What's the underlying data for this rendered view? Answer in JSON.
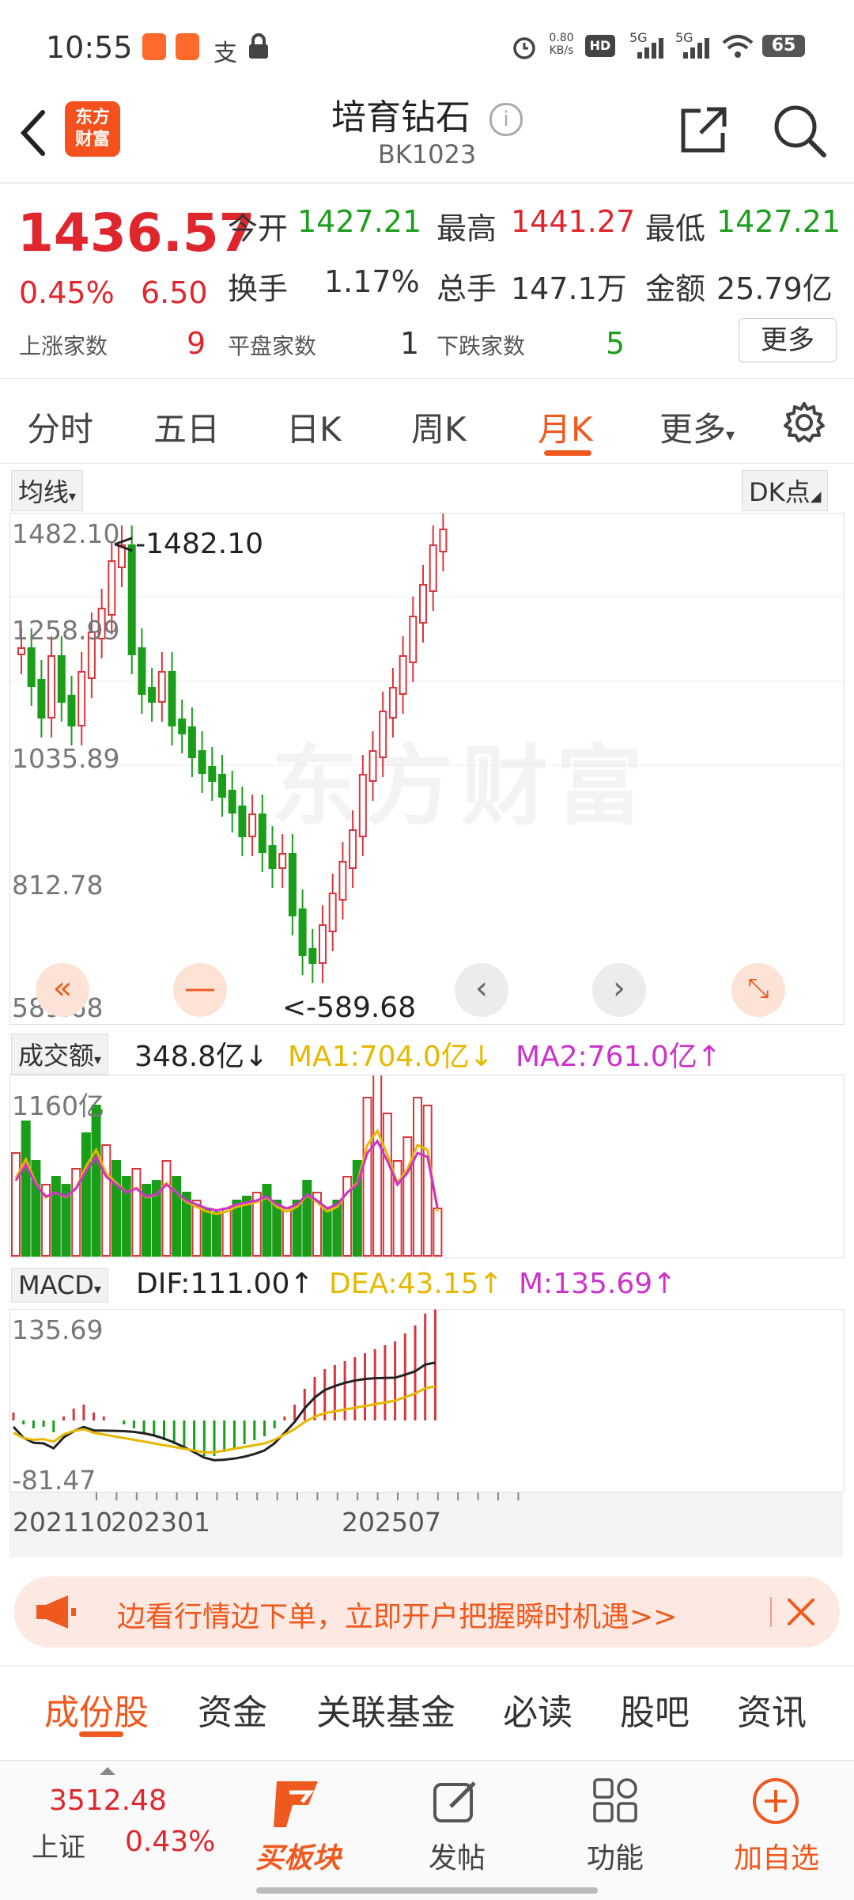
{
  "status_bar": {
    "time": "10:55",
    "net_speed_value": "0.80",
    "net_speed_unit": "KB/s",
    "sim1": "5G",
    "sim2": "5G",
    "battery": "65"
  },
  "header": {
    "title": "培育钻石",
    "code": "BK1023",
    "brand_line1": "东方",
    "brand_line2": "财富"
  },
  "quote": {
    "price": "1436.57",
    "change_pct": "0.45%",
    "change": "6.50",
    "open_label": "今开",
    "open": "1427.21",
    "high_label": "最高",
    "high": "1441.27",
    "low_label": "最低",
    "low": "1427.21",
    "turnover_label": "换手",
    "turnover": "1.17%",
    "volume_label": "总手",
    "volume": "147.1万",
    "amount_label": "金额",
    "amount": "25.79亿",
    "up_label": "上涨家数",
    "up": "9",
    "flat_label": "平盘家数",
    "flat": "1",
    "down_label": "下跌家数",
    "down": "5",
    "more_button": "更多"
  },
  "period_tabs": {
    "items": [
      "分时",
      "五日",
      "日K",
      "周K",
      "月K",
      "更多"
    ],
    "active": "月K"
  },
  "chart": {
    "ma_selector": "均线",
    "dk_selector": "DK点",
    "y_labels": [
      "1482.10",
      "1258.99",
      "1035.89",
      "812.78",
      "589.68"
    ],
    "max_marker": "<-1482.10",
    "min_marker": "<-589.68",
    "watermark": "东方财富",
    "volume_selector": "成交额",
    "volume_value": "348.8亿↓",
    "ma1": "MA1:704.0亿↓",
    "ma2": "MA2:761.0亿↑",
    "volume_max": "1160亿",
    "macd_selector": "MACD",
    "dif": "DIF:111.00↑",
    "dea": "DEA:43.15↑",
    "m": "M:135.69↑",
    "macd_max": "135.69",
    "macd_min": "-81.47",
    "x_labels": [
      "202110",
      "202301",
      "202507"
    ],
    "colors": {
      "up": "#d9363e",
      "down": "#1a9e1a",
      "ma1": "#e6b800",
      "ma2": "#cc33cc",
      "dif": "#222222"
    }
  },
  "banner": {
    "text": "边看行情边下单，立即开户把握瞬时机遇>>"
  },
  "bottom_tabs": {
    "items": [
      "成份股",
      "资金",
      "关联基金",
      "必读",
      "股吧",
      "资讯"
    ],
    "active": "成份股"
  },
  "bottom_bar": {
    "index_value": "3512.48",
    "index_name": "上证",
    "index_pct": "0.43%",
    "buy_label": "买板块",
    "post_label": "发帖",
    "func_label": "功能",
    "add_label": "加自选"
  }
}
